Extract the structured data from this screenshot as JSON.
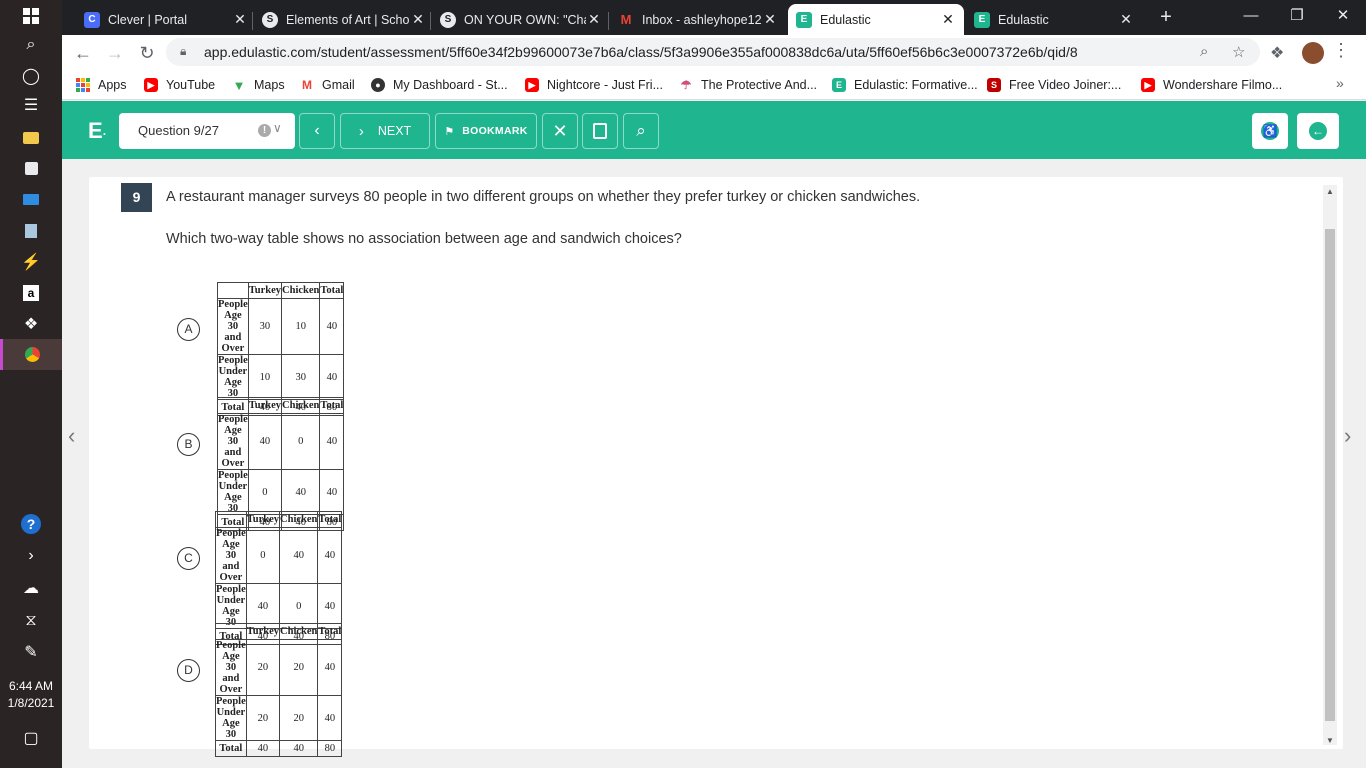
{
  "taskbar": {
    "clock_time": "6:44 AM",
    "clock_date": "1/8/2021"
  },
  "browser": {
    "tabs": [
      {
        "title": "Clever | Portal",
        "favicon": "C",
        "color": "#4a6cf7"
      },
      {
        "title": "Elements of Art | Scho",
        "favicon": "S",
        "color": "#3c4043"
      },
      {
        "title": "ON YOUR OWN: \"Cha",
        "favicon": "S",
        "color": "#3c4043"
      },
      {
        "title": "Inbox - ashleyhope12",
        "favicon": "M",
        "color": "#ea4335"
      },
      {
        "title": "Edulastic",
        "favicon": "E",
        "color": "#1fb58f"
      },
      {
        "title": "Edulastic",
        "favicon": "E",
        "color": "#1fb58f"
      }
    ],
    "url": "app.edulastic.com/student/assessment/5ff60e34f2b99600073e7b6a/class/5f3a9906e355af000838dc6a/uta/5ff60ef56b6c3e0007372e6b/qid/8",
    "bookmarks": [
      {
        "label": "Apps",
        "color": "#ea4335"
      },
      {
        "label": "YouTube",
        "color": "#ff0000"
      },
      {
        "label": "Maps",
        "color": "#34a853"
      },
      {
        "label": "Gmail",
        "color": "#ea4335"
      },
      {
        "label": "My Dashboard - St...",
        "color": "#333333"
      },
      {
        "label": "Nightcore - Just Fri...",
        "color": "#ff0000"
      },
      {
        "label": "The Protective And...",
        "color": "#d0507a"
      },
      {
        "label": "Edulastic: Formative...",
        "color": "#1fb58f"
      },
      {
        "label": "Free Video Joiner:...",
        "color": "#c00000"
      },
      {
        "label": "Wondershare Filmo...",
        "color": "#ff0000"
      }
    ]
  },
  "header": {
    "logo": "E",
    "question_select": "Question 9/27",
    "next_label": "NEXT",
    "bookmark_label": "BOOKMARK",
    "accent_color": "#1fb58f"
  },
  "question": {
    "number": "9",
    "stem": "A restaurant manager surveys 80 people in two different groups on whether they prefer turkey or chicken sandwiches.",
    "prompt": "Which two-way table shows no association between age and sandwich choices?",
    "column_headers": [
      "Turkey",
      "Chicken",
      "Total"
    ],
    "row_labels": [
      "People Age 30 and Over",
      "People Under Age 30",
      "Total"
    ],
    "options": [
      {
        "letter": "A",
        "rows": [
          [
            "30",
            "10",
            "40"
          ],
          [
            "10",
            "30",
            "40"
          ],
          [
            "40",
            "40",
            "80"
          ]
        ]
      },
      {
        "letter": "B",
        "rows": [
          [
            "40",
            "0",
            "40"
          ],
          [
            "0",
            "40",
            "40"
          ],
          [
            "40",
            "40",
            "80"
          ]
        ]
      },
      {
        "letter": "C",
        "rows": [
          [
            "0",
            "40",
            "40"
          ],
          [
            "40",
            "0",
            "40"
          ],
          [
            "40",
            "40",
            "80"
          ]
        ]
      },
      {
        "letter": "D",
        "rows": [
          [
            "20",
            "20",
            "40"
          ],
          [
            "20",
            "20",
            "40"
          ],
          [
            "40",
            "40",
            "80"
          ]
        ]
      }
    ]
  }
}
